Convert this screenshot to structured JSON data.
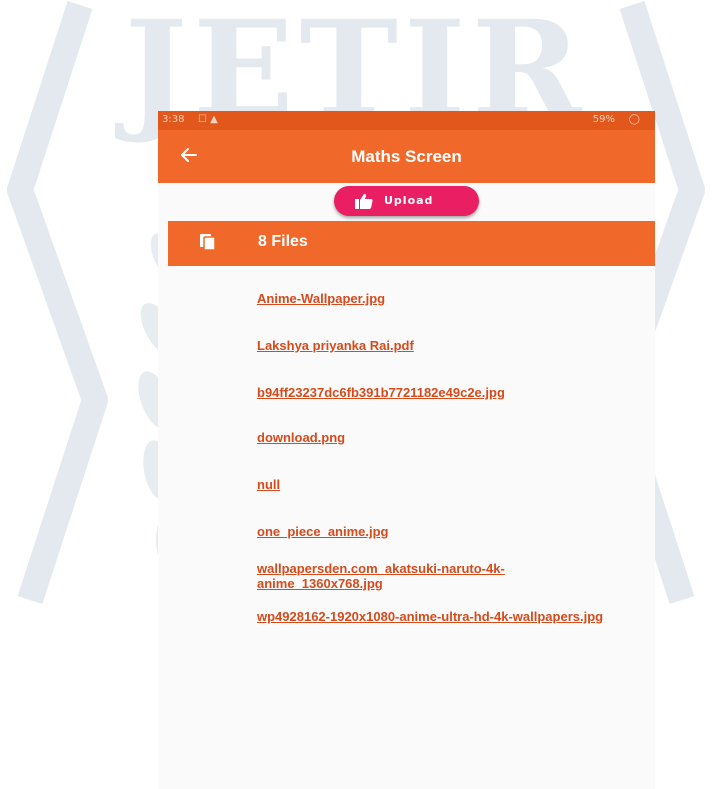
{
  "watermark": {
    "text": "JETIR"
  },
  "status_bar": {
    "time": "3:38",
    "battery": "59%"
  },
  "app_bar": {
    "back_icon": "arrow-left-icon",
    "title": "Maths Screen"
  },
  "upload_button": {
    "icon": "thumbs-up-icon",
    "label": "Upload"
  },
  "files_header": {
    "icon": "copy-files-icon",
    "count_label": "8 Files"
  },
  "files": [
    "Anime-Wallpaper.jpg",
    "Lakshya priyanka Rai.pdf",
    "b94ff23237dc6fb391b7721182e49c2e.jpg",
    "download.png",
    "null",
    "one_piece_anime.jpg",
    "wallpapersden.com_akatsuki-naruto-4k-anime_1360x768.jpg",
    "wp4928162-1920x1080-anime-ultra-hd-4k-wallpapers.jpg"
  ],
  "colors": {
    "app_bar": "#f1692a",
    "status_bar": "#e2581c",
    "upload_button": "#e91e63",
    "link": "#d64a1b"
  }
}
